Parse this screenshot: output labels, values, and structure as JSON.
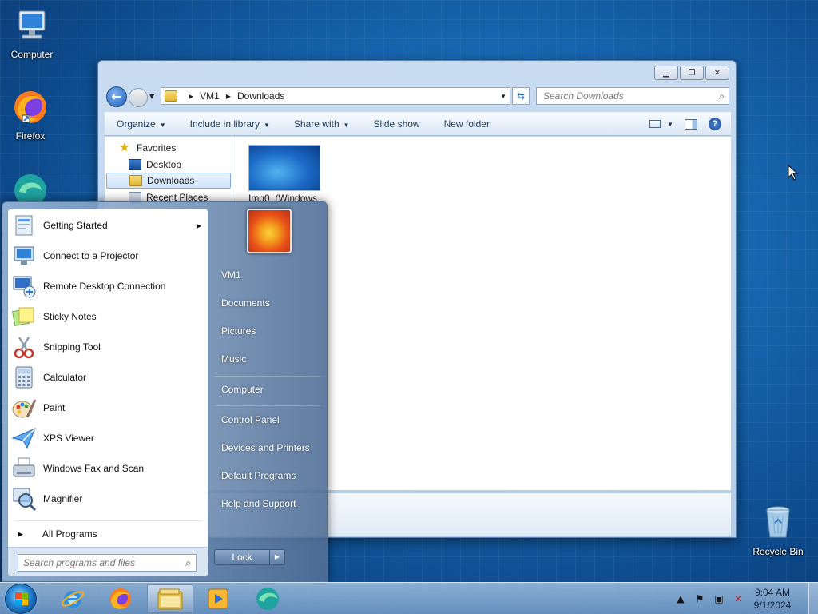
{
  "desktop": {
    "icons": [
      {
        "label": "Computer",
        "icon": "computer-icon"
      },
      {
        "label": "Firefox",
        "icon": "firefox-icon"
      },
      {
        "label": "Recycle Bin",
        "icon": "recycle-bin-icon"
      }
    ]
  },
  "explorer": {
    "address": {
      "root": "VM1",
      "folder": "Downloads"
    },
    "search_placeholder": "Search Downloads",
    "toolbar": {
      "organize": "Organize",
      "include_in_library": "Include in library",
      "share_with": "Share with",
      "slide_show": "Slide show",
      "new_folder": "New folder"
    },
    "navpane": {
      "favorites": "Favorites",
      "desktop": "Desktop",
      "downloads": "Downloads",
      "recent_places": "Recent Places"
    },
    "files": [
      {
        "name": "Img0_(Windows",
        "icon": "image-thumbnail"
      }
    ]
  },
  "start_menu": {
    "programs": [
      {
        "label": "Getting Started",
        "has_submenu": true,
        "icon": "getting-started-icon"
      },
      {
        "label": "Connect to a Projector",
        "icon": "projector-icon"
      },
      {
        "label": "Remote Desktop Connection",
        "icon": "remote-desktop-icon"
      },
      {
        "label": "Sticky Notes",
        "icon": "sticky-notes-icon"
      },
      {
        "label": "Snipping Tool",
        "icon": "snipping-tool-icon"
      },
      {
        "label": "Calculator",
        "icon": "calculator-icon"
      },
      {
        "label": "Paint",
        "icon": "paint-icon"
      },
      {
        "label": "XPS Viewer",
        "icon": "xps-viewer-icon"
      },
      {
        "label": "Windows Fax and Scan",
        "icon": "fax-scan-icon"
      },
      {
        "label": "Magnifier",
        "icon": "magnifier-icon"
      }
    ],
    "all_programs": "All Programs",
    "search_placeholder": "Search programs and files",
    "right": {
      "user": "VM1",
      "documents": "Documents",
      "pictures": "Pictures",
      "music": "Music",
      "computer": "Computer",
      "control_panel": "Control Panel",
      "devices_printers": "Devices and Printers",
      "default_programs": "Default Programs",
      "help_support": "Help and Support"
    },
    "lock": "Lock"
  },
  "taskbar": {
    "apps": [
      "internet-explorer-icon",
      "firefox-icon",
      "file-explorer-icon",
      "media-center-icon",
      "edge-icon"
    ],
    "clock": {
      "time": "9:04 AM",
      "date": "9/1/2024"
    }
  }
}
